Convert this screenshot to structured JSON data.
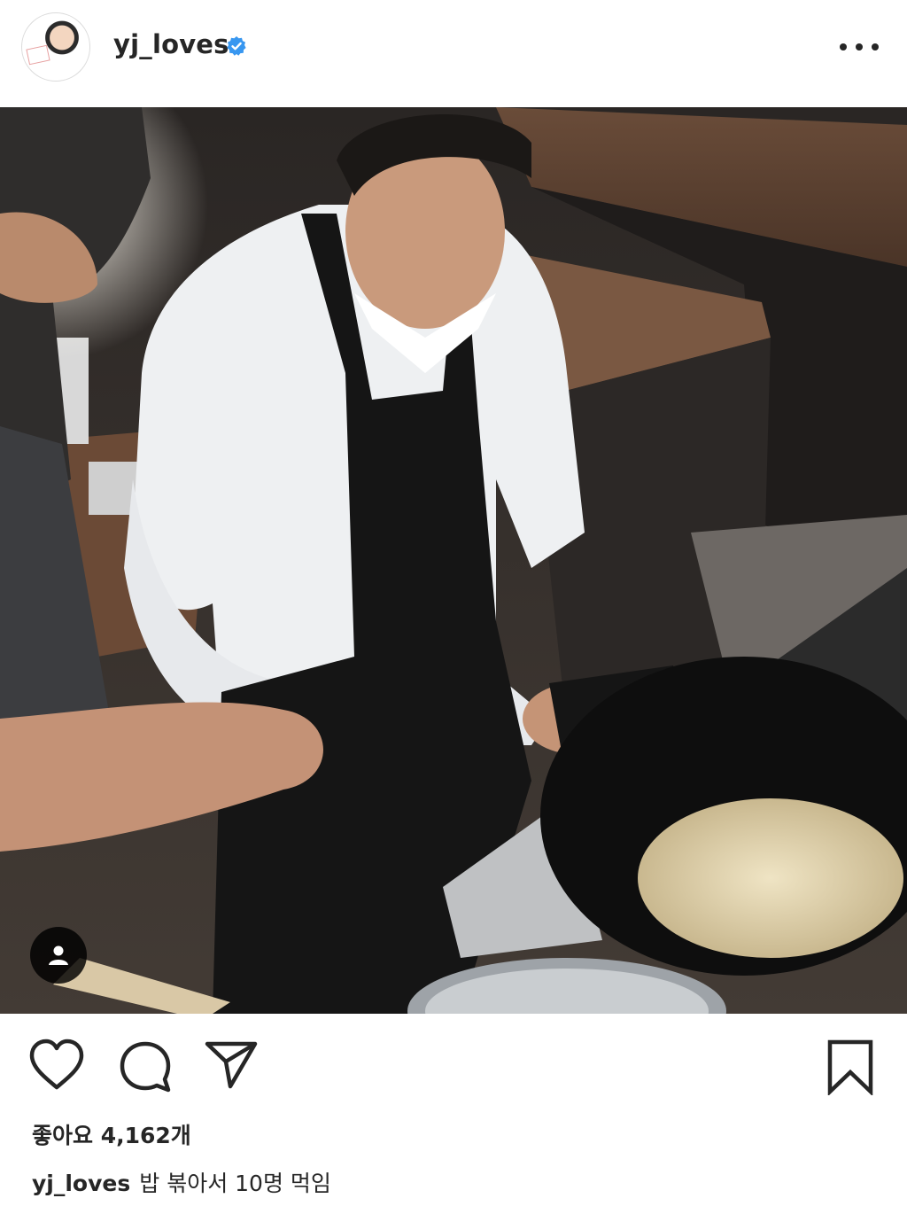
{
  "post": {
    "username": "yj_loves",
    "verified": true,
    "likes_label": "좋아요 4,162개",
    "caption_user": "yj_loves",
    "caption_text": "밥 볶아서 10명 먹임"
  },
  "icons": {
    "more": "more-horizontal-icon",
    "verified": "verified-badge-icon",
    "user_tag": "user-tag-icon",
    "like": "heart-icon",
    "comment": "comment-icon",
    "share": "paper-plane-icon",
    "save": "bookmark-icon"
  },
  "colors": {
    "text": "#262626",
    "verified_blue": "#3897f0",
    "divider": "#dbdbdb"
  }
}
